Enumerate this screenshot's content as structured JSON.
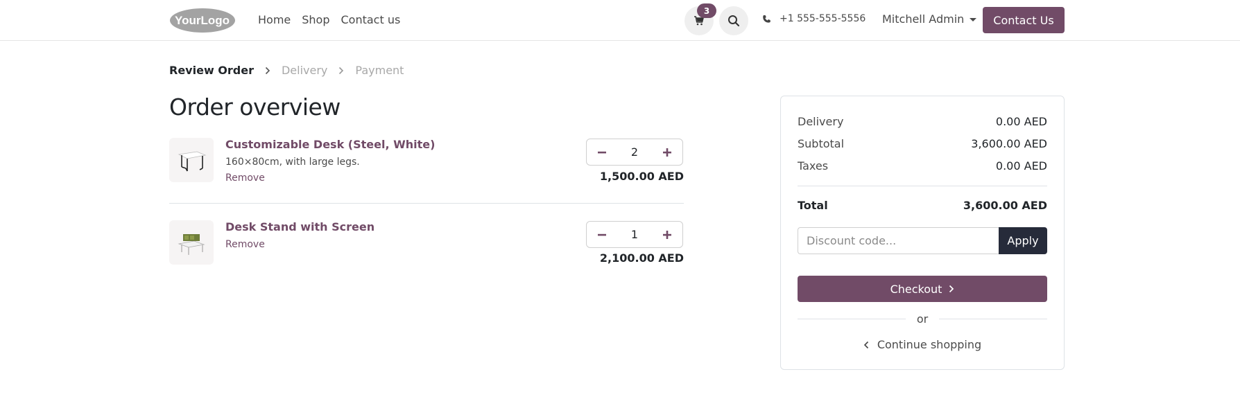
{
  "header": {
    "logo_text": "YourLogo",
    "nav": [
      "Home",
      "Shop",
      "Contact us"
    ],
    "cart_count": "3",
    "phone": "+1 555-555-5556",
    "user": "Mitchell Admin",
    "contact_button": "Contact Us"
  },
  "steps": {
    "review": "Review Order",
    "delivery": "Delivery",
    "payment": "Payment"
  },
  "page_title": "Order overview",
  "lines": [
    {
      "name": "Customizable Desk (Steel, White)",
      "description": "160×80cm, with large legs.",
      "remove": "Remove",
      "qty": "2",
      "price": "1,500.00 AED"
    },
    {
      "name": "Desk Stand with Screen",
      "remove": "Remove",
      "qty": "1",
      "price": "2,100.00 AED"
    }
  ],
  "summary": {
    "delivery_label": "Delivery",
    "delivery_value": "0.00 AED",
    "subtotal_label": "Subtotal",
    "subtotal_value": "3,600.00 AED",
    "taxes_label": "Taxes",
    "taxes_value": "0.00 AED",
    "total_label": "Total",
    "total_value": "3,600.00 AED",
    "discount_placeholder": "Discount code...",
    "apply": "Apply",
    "checkout": "Checkout",
    "or": "or",
    "continue": "Continue shopping"
  },
  "colors": {
    "brand": "#714b67",
    "apply_bg": "#262b3a"
  },
  "icons": {
    "cart": "cart-icon",
    "search": "search-icon",
    "phone": "phone-icon",
    "chevron": "chevron-right-icon",
    "back": "chevron-left-icon"
  }
}
